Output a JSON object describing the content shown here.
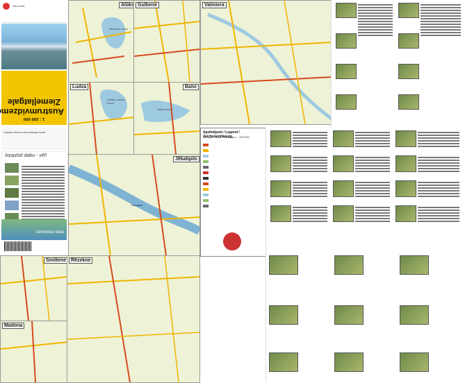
{
  "cover": {
    "title_line1": "Austrumvidzeme",
    "title_line2": "Ziemeļlatgale",
    "scale": "1 : 200 000",
    "logo_text": "Jāņa sēta",
    "subtitle_strip": "Iepazīsti dabu - vēl!",
    "brand_text": "Latvijas tūrisma informācijas karte",
    "publisher_strip": "Jāņa sēta",
    "lower_logo": "zemnieka vieta"
  },
  "maps": {
    "aluksne": {
      "label": "Alūksne",
      "lake": "Alūksnes ezers"
    },
    "gulbene": {
      "label": "Gulbene"
    },
    "valmiera": {
      "label": "Valmiera"
    },
    "ludza": {
      "label": "Ludza",
      "lake": "Lielais Ludzas ezers"
    },
    "balvi": {
      "label": "Balvi",
      "lake": "Balvu ezers"
    },
    "jekabpils": {
      "label": "Jēkabpils",
      "river": "Daugava"
    },
    "smiltene": {
      "label": "Smiltene"
    },
    "madona": {
      "label": "Madona"
    },
    "rezekne": {
      "label": "Rēzekne"
    }
  },
  "legend": {
    "title": "Apzīmējumi / Legend / Zeichenerklärung",
    "subtitle": "Mērogs / Scale / Maßstab 1 : 200 000"
  },
  "colors": {
    "yellow": "#f3c500",
    "map_bg": "#eef2d6",
    "water": "#9ecae1",
    "road": "#f0b400",
    "main_road": "#d64a1f",
    "green": "#8fbf6a"
  }
}
